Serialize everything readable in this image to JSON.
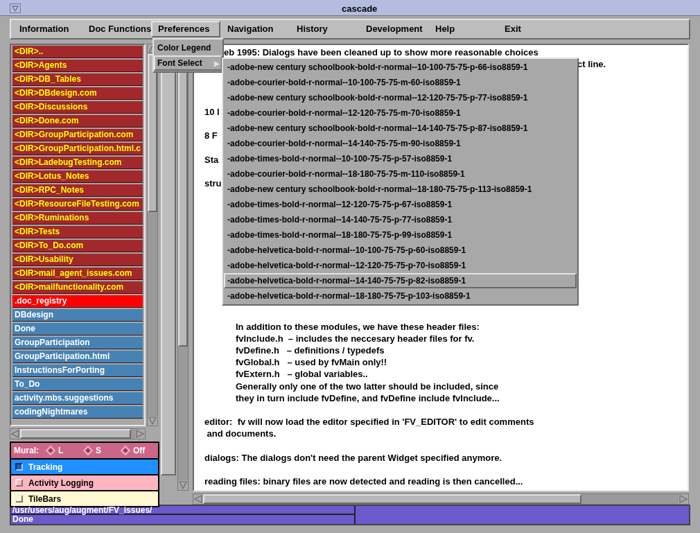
{
  "window": {
    "title": "cascade"
  },
  "menu_bar": [
    {
      "label": "Information",
      "selected": false
    },
    {
      "label": "Doc Functions",
      "selected": false
    },
    {
      "label": "Preferences",
      "selected": true
    },
    {
      "label": "Navigation",
      "selected": false
    },
    {
      "label": "History",
      "selected": false
    },
    {
      "label": "Development",
      "selected": false
    },
    {
      "label": "Help",
      "selected": false
    },
    {
      "label": "Exit",
      "selected": false
    }
  ],
  "preferences_menu": [
    {
      "label": "Color Legend",
      "selected": false
    },
    {
      "label": "Font Select",
      "selected": true,
      "arrow": "▶"
    }
  ],
  "font_menu": [
    {
      "label": "-adobe-new century schoolbook-bold-r-normal--10-100-75-75-p-66-iso8859-1",
      "selected": false
    },
    {
      "label": "-adobe-courier-bold-r-normal--10-100-75-75-m-60-iso8859-1",
      "selected": false
    },
    {
      "label": "-adobe-new century schoolbook-bold-r-normal--12-120-75-75-p-77-iso8859-1",
      "selected": false
    },
    {
      "label": "-adobe-courier-bold-r-normal--12-120-75-75-m-70-iso8859-1",
      "selected": false
    },
    {
      "label": "-adobe-new century schoolbook-bold-r-normal--14-140-75-75-p-87-iso8859-1",
      "selected": false
    },
    {
      "label": "-adobe-courier-bold-r-normal--14-140-75-75-m-90-iso8859-1",
      "selected": false
    },
    {
      "label": "-adobe-times-bold-r-normal--10-100-75-75-p-57-iso8859-1",
      "selected": false
    },
    {
      "label": "-adobe-courier-bold-r-normal--18-180-75-75-m-110-iso8859-1",
      "selected": false
    },
    {
      "label": "-adobe-new century schoolbook-bold-r-normal--18-180-75-75-p-113-iso8859-1",
      "selected": false
    },
    {
      "label": "-adobe-times-bold-r-normal--12-120-75-75-p-67-iso8859-1",
      "selected": false
    },
    {
      "label": "-adobe-times-bold-r-normal--14-140-75-75-p-77-iso8859-1",
      "selected": false
    },
    {
      "label": "-adobe-times-bold-r-normal--18-180-75-75-p-99-iso8859-1",
      "selected": false
    },
    {
      "label": "-adobe-helvetica-bold-r-normal--10-100-75-75-p-60-iso8859-1",
      "selected": false
    },
    {
      "label": "-adobe-helvetica-bold-r-normal--12-120-75-75-p-70-iso8859-1",
      "selected": false
    },
    {
      "label": "-adobe-helvetica-bold-r-normal--14-140-75-75-p-82-iso8859-1",
      "selected": true
    },
    {
      "label": "-adobe-helvetica-bold-r-normal--18-180-75-75-p-103-iso8859-1",
      "selected": false
    }
  ],
  "file_list": [
    {
      "label": "<DIR>..",
      "kind": "dir",
      "selected": false
    },
    {
      "label": "<DIR>Agents",
      "kind": "dir",
      "selected": false
    },
    {
      "label": "<DIR>DB_Tables",
      "kind": "dir",
      "selected": false
    },
    {
      "label": "<DIR>DBdesign.com",
      "kind": "dir",
      "selected": false
    },
    {
      "label": "<DIR>Discussions",
      "kind": "dir",
      "selected": false
    },
    {
      "label": "<DIR>Done.com",
      "kind": "dir",
      "selected": false
    },
    {
      "label": "<DIR>GroupParticipation.com",
      "kind": "dir",
      "selected": false
    },
    {
      "label": "<DIR>GroupParticipation.html.c",
      "kind": "dir",
      "selected": false
    },
    {
      "label": "<DIR>LadebugTesting.com",
      "kind": "dir",
      "selected": false
    },
    {
      "label": "<DIR>Lotus_Notes",
      "kind": "dir",
      "selected": false
    },
    {
      "label": "<DIR>RPC_Notes",
      "kind": "dir",
      "selected": false
    },
    {
      "label": "<DIR>ResourceFileTesting.com",
      "kind": "dir",
      "selected": false
    },
    {
      "label": "<DIR>Ruminations",
      "kind": "dir",
      "selected": false
    },
    {
      "label": "<DIR>Tests",
      "kind": "dir",
      "selected": false
    },
    {
      "label": "<DIR>To_Do.com",
      "kind": "dir",
      "selected": false
    },
    {
      "label": "<DIR>Usability",
      "kind": "dir",
      "selected": false
    },
    {
      "label": "<DIR>mail_agent_issues.com",
      "kind": "dir",
      "selected": false
    },
    {
      "label": "<DIR>mailfunctionality.com",
      "kind": "dir",
      "selected": false
    },
    {
      "label": ".doc_registry",
      "kind": "file",
      "selected": true
    },
    {
      "label": "DBdesign",
      "kind": "file",
      "selected": false
    },
    {
      "label": "Done",
      "kind": "file",
      "selected": false
    },
    {
      "label": "GroupParticipation",
      "kind": "file",
      "selected": false
    },
    {
      "label": "GroupParticipation.html",
      "kind": "file",
      "selected": false
    },
    {
      "label": "InstructionsForPorting",
      "kind": "file",
      "selected": false
    },
    {
      "label": "To_Do",
      "kind": "file",
      "selected": false
    },
    {
      "label": "activity.mbs.suggestions",
      "kind": "file",
      "selected": false
    },
    {
      "label": "codingNightmares",
      "kind": "file",
      "selected": false
    }
  ],
  "mural": {
    "label": "Mural:",
    "color": "#cc6688",
    "options": [
      {
        "label": "L",
        "selected": false
      },
      {
        "label": "S",
        "selected": false
      },
      {
        "label": "Off",
        "selected": false
      }
    ]
  },
  "toggles": [
    {
      "label": "Tracking",
      "checked": true,
      "color": "#1e90ff"
    },
    {
      "label": "Activity Logging",
      "checked": false,
      "color": "#ffb6c1"
    },
    {
      "label": "TileBars",
      "checked": false,
      "color": "#fff8d0"
    }
  ],
  "document": [
    {
      "kind": "head",
      "text": "eb 1995: Dialogs have been cleaned up to show more reasonable choices"
    },
    {
      "kind": "tail",
      "text": "ct line."
    },
    {
      "kind": "para",
      "text": "10 l"
    },
    {
      "kind": "para",
      "text": "8 F"
    },
    {
      "kind": "para",
      "text": "Sta"
    },
    {
      "kind": "para",
      "text": "stru"
    },
    {
      "kind": "indented",
      "text": "In addition to these modules, we have these header files:"
    },
    {
      "kind": "indented",
      "text": "fvInclude.h  – includes the neccesary header files for fv."
    },
    {
      "kind": "indented",
      "text": "fvDefine.h   – definitions / typedefs"
    },
    {
      "kind": "indented",
      "text": "fvGlobal.h   – used by fvMain only!!"
    },
    {
      "kind": "indented",
      "text": "fvExtern.h   – global variables.."
    },
    {
      "kind": "indented",
      "text": "Generally only one of the two latter should be included, since"
    },
    {
      "kind": "indented",
      "text": "they in turn include fvDefine, and fvDefine include fvInclude..."
    },
    {
      "kind": "para",
      "text": "editor:  fv will now load the editor specified in 'FV_EDITOR' to edit comments"
    },
    {
      "kind": "para",
      "text": " and documents."
    },
    {
      "kind": "para",
      "text": "dialogs: The dialogs don't need the parent Widget specified anymore."
    },
    {
      "kind": "para",
      "text": "reading files: binary files are now detected and reading is then cancelled..."
    }
  ],
  "status": {
    "path": "/usr/users/aug/augment/FV_issues/",
    "message": "Done"
  }
}
